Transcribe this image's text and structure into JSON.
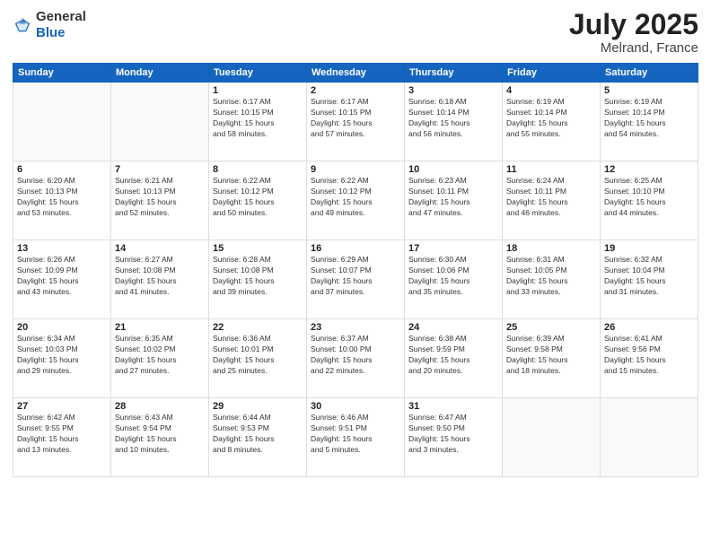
{
  "header": {
    "logo_general": "General",
    "logo_blue": "Blue",
    "month": "July 2025",
    "location": "Melrand, France"
  },
  "weekdays": [
    "Sunday",
    "Monday",
    "Tuesday",
    "Wednesday",
    "Thursday",
    "Friday",
    "Saturday"
  ],
  "weeks": [
    [
      {
        "day": "",
        "info": ""
      },
      {
        "day": "",
        "info": ""
      },
      {
        "day": "1",
        "info": "Sunrise: 6:17 AM\nSunset: 10:15 PM\nDaylight: 15 hours\nand 58 minutes."
      },
      {
        "day": "2",
        "info": "Sunrise: 6:17 AM\nSunset: 10:15 PM\nDaylight: 15 hours\nand 57 minutes."
      },
      {
        "day": "3",
        "info": "Sunrise: 6:18 AM\nSunset: 10:14 PM\nDaylight: 15 hours\nand 56 minutes."
      },
      {
        "day": "4",
        "info": "Sunrise: 6:19 AM\nSunset: 10:14 PM\nDaylight: 15 hours\nand 55 minutes."
      },
      {
        "day": "5",
        "info": "Sunrise: 6:19 AM\nSunset: 10:14 PM\nDaylight: 15 hours\nand 54 minutes."
      }
    ],
    [
      {
        "day": "6",
        "info": "Sunrise: 6:20 AM\nSunset: 10:13 PM\nDaylight: 15 hours\nand 53 minutes."
      },
      {
        "day": "7",
        "info": "Sunrise: 6:21 AM\nSunset: 10:13 PM\nDaylight: 15 hours\nand 52 minutes."
      },
      {
        "day": "8",
        "info": "Sunrise: 6:22 AM\nSunset: 10:12 PM\nDaylight: 15 hours\nand 50 minutes."
      },
      {
        "day": "9",
        "info": "Sunrise: 6:22 AM\nSunset: 10:12 PM\nDaylight: 15 hours\nand 49 minutes."
      },
      {
        "day": "10",
        "info": "Sunrise: 6:23 AM\nSunset: 10:11 PM\nDaylight: 15 hours\nand 47 minutes."
      },
      {
        "day": "11",
        "info": "Sunrise: 6:24 AM\nSunset: 10:11 PM\nDaylight: 15 hours\nand 46 minutes."
      },
      {
        "day": "12",
        "info": "Sunrise: 6:25 AM\nSunset: 10:10 PM\nDaylight: 15 hours\nand 44 minutes."
      }
    ],
    [
      {
        "day": "13",
        "info": "Sunrise: 6:26 AM\nSunset: 10:09 PM\nDaylight: 15 hours\nand 43 minutes."
      },
      {
        "day": "14",
        "info": "Sunrise: 6:27 AM\nSunset: 10:08 PM\nDaylight: 15 hours\nand 41 minutes."
      },
      {
        "day": "15",
        "info": "Sunrise: 6:28 AM\nSunset: 10:08 PM\nDaylight: 15 hours\nand 39 minutes."
      },
      {
        "day": "16",
        "info": "Sunrise: 6:29 AM\nSunset: 10:07 PM\nDaylight: 15 hours\nand 37 minutes."
      },
      {
        "day": "17",
        "info": "Sunrise: 6:30 AM\nSunset: 10:06 PM\nDaylight: 15 hours\nand 35 minutes."
      },
      {
        "day": "18",
        "info": "Sunrise: 6:31 AM\nSunset: 10:05 PM\nDaylight: 15 hours\nand 33 minutes."
      },
      {
        "day": "19",
        "info": "Sunrise: 6:32 AM\nSunset: 10:04 PM\nDaylight: 15 hours\nand 31 minutes."
      }
    ],
    [
      {
        "day": "20",
        "info": "Sunrise: 6:34 AM\nSunset: 10:03 PM\nDaylight: 15 hours\nand 29 minutes."
      },
      {
        "day": "21",
        "info": "Sunrise: 6:35 AM\nSunset: 10:02 PM\nDaylight: 15 hours\nand 27 minutes."
      },
      {
        "day": "22",
        "info": "Sunrise: 6:36 AM\nSunset: 10:01 PM\nDaylight: 15 hours\nand 25 minutes."
      },
      {
        "day": "23",
        "info": "Sunrise: 6:37 AM\nSunset: 10:00 PM\nDaylight: 15 hours\nand 22 minutes."
      },
      {
        "day": "24",
        "info": "Sunrise: 6:38 AM\nSunset: 9:59 PM\nDaylight: 15 hours\nand 20 minutes."
      },
      {
        "day": "25",
        "info": "Sunrise: 6:39 AM\nSunset: 9:58 PM\nDaylight: 15 hours\nand 18 minutes."
      },
      {
        "day": "26",
        "info": "Sunrise: 6:41 AM\nSunset: 9:56 PM\nDaylight: 15 hours\nand 15 minutes."
      }
    ],
    [
      {
        "day": "27",
        "info": "Sunrise: 6:42 AM\nSunset: 9:55 PM\nDaylight: 15 hours\nand 13 minutes."
      },
      {
        "day": "28",
        "info": "Sunrise: 6:43 AM\nSunset: 9:54 PM\nDaylight: 15 hours\nand 10 minutes."
      },
      {
        "day": "29",
        "info": "Sunrise: 6:44 AM\nSunset: 9:53 PM\nDaylight: 15 hours\nand 8 minutes."
      },
      {
        "day": "30",
        "info": "Sunrise: 6:46 AM\nSunset: 9:51 PM\nDaylight: 15 hours\nand 5 minutes."
      },
      {
        "day": "31",
        "info": "Sunrise: 6:47 AM\nSunset: 9:50 PM\nDaylight: 15 hours\nand 3 minutes."
      },
      {
        "day": "",
        "info": ""
      },
      {
        "day": "",
        "info": ""
      }
    ]
  ]
}
